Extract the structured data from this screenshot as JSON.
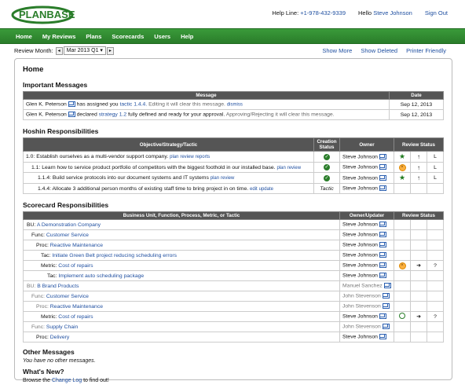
{
  "app": {
    "logo_text": "PLANBASE"
  },
  "header": {
    "helpline": "Help Line: ",
    "phone": "+1-978-432-9339",
    "hello": "Hello ",
    "user": "Steve Johnson",
    "signout": "Sign Out"
  },
  "nav": [
    "Home",
    "My Reviews",
    "Plans",
    "Scorecards",
    "Users",
    "Help"
  ],
  "subbar": {
    "review_label": "Review Month:",
    "review_value": "Mar 2013 Q1",
    "show_more": "Show More",
    "show_deleted": "Show Deleted",
    "printer": "Printer Friendly"
  },
  "page_title": "Home",
  "important": {
    "title": "Important Messages",
    "headers": [
      "Message",
      "Date"
    ],
    "rows": [
      {
        "who": "Glen K. Peterson",
        "text1": " has assigned you ",
        "link": "tactic 1.4.4.",
        "hint": "  Editing it will clear this message.",
        "action": "dismiss",
        "date": "Sep 12, 2013"
      },
      {
        "who": "Glen K. Peterson",
        "text1": " declared ",
        "link": "strategy 1.2",
        "text2": " fully defined and ready for your approval.",
        "hint": "  Approving/Rejecting it will clear this message.",
        "date": "Sep 12, 2013"
      }
    ]
  },
  "hoshin": {
    "title": "Hoshin Responsibilities",
    "headers": [
      "Objective/Strategy/Tactic",
      "Creation Status",
      "Owner",
      "Review Status"
    ],
    "rows": [
      {
        "text": "1.0: Establish ourselves as a multi-vendor support company.",
        "links": [
          "plan",
          "review",
          "reports"
        ],
        "owner": "Steve Johnson",
        "status": "check",
        "r1": "star",
        "r2": "↑",
        "r3": "L"
      },
      {
        "text": "1.1: Learn how to service product portfolio of competitors with the biggest foothold in our installed base.",
        "links": [
          "plan",
          "review"
        ],
        "owner": "Steve Johnson",
        "status": "check",
        "r1": "x",
        "r2": "↑",
        "r3": "L"
      },
      {
        "text": "1.1.4: Build service protocols into our document systems and IT systems",
        "links": [
          "plan",
          "review"
        ],
        "owner": "Steve Johnson",
        "status": "check",
        "r1": "star",
        "r2": "↑",
        "r3": "L"
      },
      {
        "text": "1.4.4: Allocate 3 additional person months of existing staff time to bring project in on time.",
        "links": [
          "edit",
          "update"
        ],
        "owner": "Steve Johnson",
        "status": "Tactic",
        "r1": "",
        "r2": "",
        "r3": ""
      }
    ]
  },
  "scorecard": {
    "title": "Scorecard Responsibilities",
    "headers": [
      "Business Unit, Function, Process, Metric, or Tactic",
      "Owner/Updater",
      "Review Status"
    ],
    "rows": [
      {
        "label": "BU: ",
        "link": "A Demonstration Company",
        "owner": "Steve Johnson",
        "indent": 0,
        "gray": false
      },
      {
        "label": "Func: ",
        "link": "Customer Service",
        "owner": "Steve Johnson",
        "indent": 1,
        "gray": false
      },
      {
        "label": "Proc: ",
        "link": "Reactive Maintenance",
        "owner": "Steve Johnson",
        "indent": 2,
        "gray": false
      },
      {
        "label": "Tac: ",
        "link": "Initiate Green Belt project reducing scheduling errors",
        "owner": "Steve Johnson",
        "indent": 3,
        "gray": false
      },
      {
        "label": "Metric: ",
        "link": "Cost of repairs",
        "owner": "Steve Johnson",
        "indent": 3,
        "gray": false,
        "r1": "x",
        "r2": "➜",
        "r3": "?"
      },
      {
        "label": "Tac: ",
        "link": "Implement auto scheduling package",
        "owner": "Steve Johnson",
        "indent": 4,
        "gray": false
      },
      {
        "label": "BU: ",
        "link": "B Brand Products",
        "owner": "Manuel Sanchez",
        "indent": 0,
        "gray": true
      },
      {
        "label": "Func: ",
        "link": "Customer Service",
        "owner": "John Stevenson",
        "indent": 1,
        "gray": true
      },
      {
        "label": "Proc: ",
        "link": "Reactive Maintenance",
        "owner": "John Stevenson",
        "indent": 2,
        "gray": true
      },
      {
        "label": "Metric: ",
        "link": "Cost of repairs",
        "owner": "Steve Johnson",
        "indent": 3,
        "gray": false,
        "r1": "o",
        "r2": "➜",
        "r3": "?"
      },
      {
        "label": "Func: ",
        "link": "Supply Chain",
        "owner": "John Stevenson",
        "indent": 1,
        "gray": true
      },
      {
        "label": "Proc: ",
        "link": "Delivery",
        "owner": "Steve Johnson",
        "indent": 2,
        "gray": false
      }
    ]
  },
  "other": {
    "title": "Other Messages",
    "text": "You have no other messages."
  },
  "whatsnew": {
    "title": "What's New?",
    "pre": "Browse the ",
    "link": "Change Log",
    "post": " to find out!"
  },
  "colors": {
    "nav_green": "#2f8a2f",
    "header_dark": "#555555",
    "link": "#1f4fa0"
  }
}
